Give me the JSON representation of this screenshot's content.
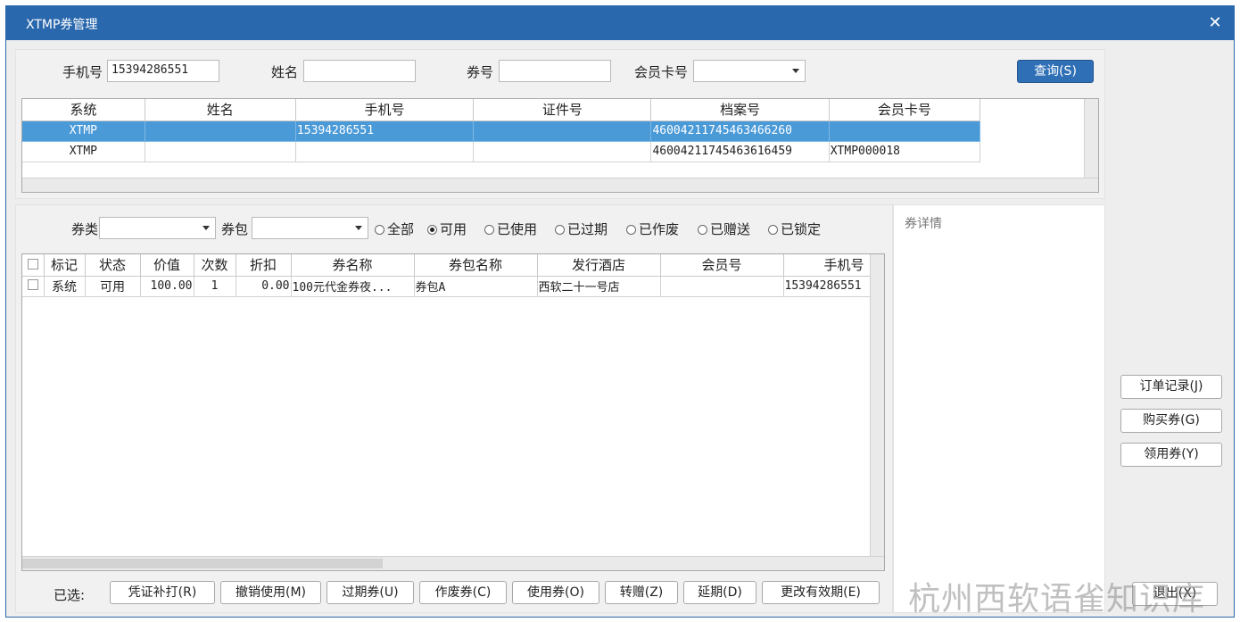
{
  "window": {
    "title": "XTMP券管理",
    "close_glyph": "✕"
  },
  "search": {
    "phone_label": "手机号",
    "phone_value": "15394286551",
    "name_label": "姓名",
    "name_value": "",
    "coupon_no_label": "券号",
    "coupon_no_value": "",
    "card_label": "会员卡号",
    "card_value": "",
    "query_button": "查询(S)"
  },
  "member_grid": {
    "columns": [
      "系统",
      "姓名",
      "手机号",
      "证件号",
      "档案号",
      "会员卡号"
    ],
    "rows": [
      {
        "system": "XTMP",
        "name": "",
        "phone": "15394286551",
        "id_no": "",
        "profile_no": "46004211745463466260",
        "card_no": "",
        "selected": true
      },
      {
        "system": "XTMP",
        "name": "",
        "phone": "",
        "id_no": "",
        "profile_no": "46004211745463616459",
        "card_no": "XTMP000018",
        "selected": false
      }
    ]
  },
  "filters": {
    "type_label": "券类",
    "type_value": "",
    "pack_label": "券包",
    "pack_value": "",
    "status_options": [
      {
        "label": "全部",
        "checked": false
      },
      {
        "label": "可用",
        "checked": true
      },
      {
        "label": "已使用",
        "checked": false
      },
      {
        "label": "已过期",
        "checked": false
      },
      {
        "label": "已作废",
        "checked": false
      },
      {
        "label": "已赠送",
        "checked": false
      },
      {
        "label": "已锁定",
        "checked": false
      }
    ]
  },
  "coupon_grid": {
    "columns": [
      "标记",
      "状态",
      "价值",
      "次数",
      "折扣",
      "券名称",
      "券包名称",
      "发行酒店",
      "会员号",
      "手机号"
    ],
    "rows": [
      {
        "mark": "系统",
        "status": "可用",
        "value": "100.00",
        "count": "1",
        "discount": "0.00",
        "name": "100元代金券夜...",
        "pack": "券包A",
        "hotel": "西软二十一号店",
        "member_no": "",
        "phone": "15394286551"
      }
    ]
  },
  "detail": {
    "title": "券详情"
  },
  "bottom": {
    "selected_label": "已选:",
    "buttons": [
      "凭证补打(R)",
      "撤销使用(M)",
      "过期券(U)",
      "作废券(C)",
      "使用券(O)",
      "转赠(Z)",
      "延期(D)",
      "更改有效期(E)"
    ],
    "exit_button": "退出(X)"
  },
  "side_buttons": [
    "订单记录(J)",
    "购买券(G)",
    "领用券(Y)"
  ],
  "watermark": "杭州西软语雀知识库"
}
